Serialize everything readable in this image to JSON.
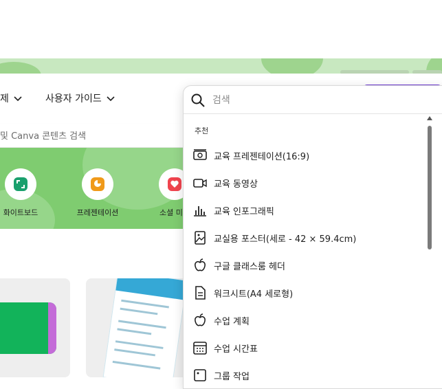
{
  "nav": {
    "item1": "제",
    "item2": "사용자 가이드"
  },
  "search_strip": {
    "placeholder": "및 Canva 콘텐츠 검색"
  },
  "categories": [
    {
      "label": "화이트보드",
      "icon": "whiteboard-icon",
      "color": "#1aa06d"
    },
    {
      "label": "프레젠테이션",
      "icon": "presentation-icon",
      "color": "#f09a1a"
    },
    {
      "label": "소셜 미디",
      "icon": "heart-icon",
      "color": "#f0444e"
    }
  ],
  "dropdown": {
    "search_placeholder": "검색",
    "section_label": "추천",
    "items": [
      {
        "label": "교육 프레젠테이션(16:9)",
        "icon": "presentation-icon"
      },
      {
        "label": "교육 동영상",
        "icon": "video-icon"
      },
      {
        "label": "교육 인포그래픽",
        "icon": "bar-chart-icon"
      },
      {
        "label": "교실용 포스터(세로 - 42 × 59.4cm)",
        "icon": "poster-icon"
      },
      {
        "label": "구글 클래스룸 헤더",
        "icon": "apple-icon"
      },
      {
        "label": "워크시트(A4 세로형)",
        "icon": "document-icon"
      },
      {
        "label": "수업 계획",
        "icon": "apple-icon"
      },
      {
        "label": "수업 시간표",
        "icon": "calendar-icon"
      },
      {
        "label": "그룹 작업",
        "icon": "image-icon"
      }
    ]
  },
  "colors": {
    "hero_green": "#7fcc70",
    "accent_purple": "#6e3ad6"
  }
}
